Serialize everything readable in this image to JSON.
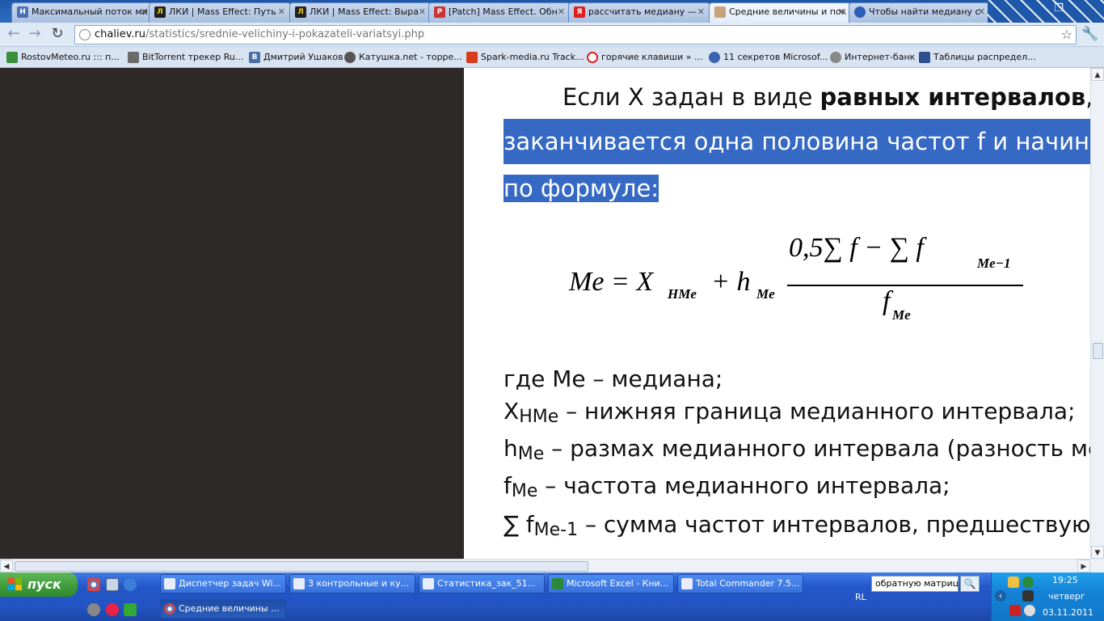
{
  "tabs": [
    {
      "label": "Максимальный поток ми",
      "icon": "h-favicon-icon",
      "active": false
    },
    {
      "label": "ЛКИ | Mass Effect: Путь",
      "icon": "lki-favicon-icon",
      "active": false
    },
    {
      "label": "ЛКИ | Mass Effect: Выра",
      "icon": "lki-favicon-icon",
      "active": false
    },
    {
      "label": "[Patch] Mass Effect. Обн",
      "icon": "patch-favicon-icon",
      "active": false
    },
    {
      "label": "рассчитать медиану — ",
      "icon": "yandex-favicon-icon",
      "active": false
    },
    {
      "label": "Средние величины и пок",
      "icon": "chaliev-favicon-icon",
      "active": true
    },
    {
      "label": "Чтобы найти медиану с",
      "icon": "search-favicon-icon",
      "active": false
    }
  ],
  "address": {
    "domain": "chaliev.ru",
    "path": "/statistics/srednie-velichiny-i-pokazateli-variatsyi.php"
  },
  "bookmarks": [
    "RostovMeteo.ru ::: п...",
    "BitTorrent трекер Ru...",
    "Дмитрий Ушаков",
    "Катушка.net - торре...",
    "Spark-media.ru Track...",
    "горячие клавиши » ...",
    "11 секретов Microsof...",
    "Интернет-банк",
    "Таблицы распредел..."
  ],
  "article": {
    "line1_prefix": "Если X задан в виде ",
    "line1_bold": "равных интервалов",
    "line1_suffix": ",",
    "line2": "заканчивается одна половина частот f и начина",
    "line3": "по формуле:",
    "formula": {
      "lhs": "Me = X",
      "sub_hme": "HMe",
      "plus_h": "+ h",
      "sub_me": "Me",
      "numerator": "0,5∑ f − ∑ f",
      "num_sub": "Me−1",
      "denominator": "f",
      "den_sub": "Me"
    },
    "defs": [
      {
        "sym": "где Ме – медиана;",
        "sub": "",
        "text": ""
      },
      {
        "sym": "X",
        "sub": "HMe",
        "text": " – нижняя граница медианного интервала;"
      },
      {
        "sym": "h",
        "sub": "Me",
        "text": " – размах медианного интервала (разность ме"
      },
      {
        "sym": "f",
        "sub": "Me",
        "text": " – частота медианного интервала;"
      },
      {
        "sym": "∑ f",
        "sub": "Me-1",
        "text": " – сумма частот интервалов, предшествую"
      }
    ]
  },
  "taskbar": {
    "start_label": "пуск",
    "tasks_row1": [
      "Диспетчер задач Wi...",
      "3 контрольные и ку...",
      "Статистика_зак_51...",
      "Microsoft Excel - Кни...",
      "Total Commander 7.5..."
    ],
    "tasks_row2": [
      "Средние величины ..."
    ],
    "search_value": "обратную матрицу",
    "lang": "RL",
    "clock_time": "19:25",
    "clock_day": "четверг",
    "clock_date": "03.11.2011"
  }
}
